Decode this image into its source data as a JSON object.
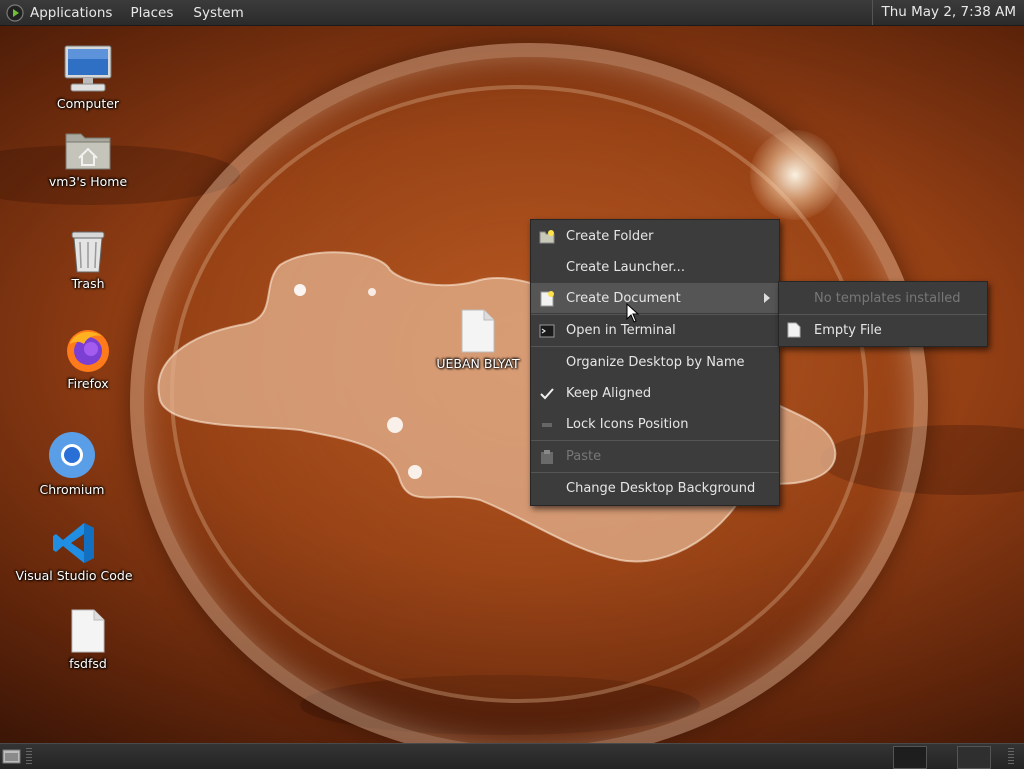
{
  "top_panel": {
    "menus": [
      "Applications",
      "Places",
      "System"
    ],
    "clock": "Thu May  2,  7:38 AM"
  },
  "desktop_icons": [
    {
      "label": "Computer",
      "icon": "computer-icon"
    },
    {
      "label": "vm3's Home",
      "icon": "home-folder-icon"
    },
    {
      "label": "Trash",
      "icon": "trash-icon"
    },
    {
      "label": "Firefox",
      "icon": "firefox-icon"
    },
    {
      "label": "Chromium",
      "icon": "chromium-icon"
    },
    {
      "label": "Visual Studio Code",
      "icon": "vscode-icon"
    },
    {
      "label": "fsdfsd",
      "icon": "file-icon"
    },
    {
      "label": "UEBAN BLYAT",
      "icon": "file-icon"
    }
  ],
  "context_menu": {
    "items": [
      {
        "label": "Create Folder",
        "icon": "new-folder-icon"
      },
      {
        "label": "Create Launcher...",
        "icon": ""
      },
      {
        "label": "Create Document",
        "icon": "new-document-icon",
        "submenu": true,
        "highlighted": true
      },
      {
        "label": "Open in Terminal",
        "icon": "terminal-icon"
      },
      {
        "label": "Organize Desktop by Name",
        "icon": ""
      },
      {
        "label": "Keep Aligned",
        "icon": "checkmark-icon",
        "checked": true
      },
      {
        "label": "Lock Icons Position",
        "icon": "unchecked-box-icon"
      },
      {
        "label": "Paste",
        "icon": "paste-icon",
        "disabled": true
      },
      {
        "label": "Change Desktop Background",
        "icon": ""
      }
    ]
  },
  "submenu": {
    "items": [
      {
        "label": "No templates installed",
        "disabled": true
      },
      {
        "label": "Empty File",
        "icon": "file-icon"
      }
    ]
  },
  "colors": {
    "panel": "#2b2b2b",
    "menu_bg": "#3c3c3c",
    "menu_hover": "#555555"
  }
}
